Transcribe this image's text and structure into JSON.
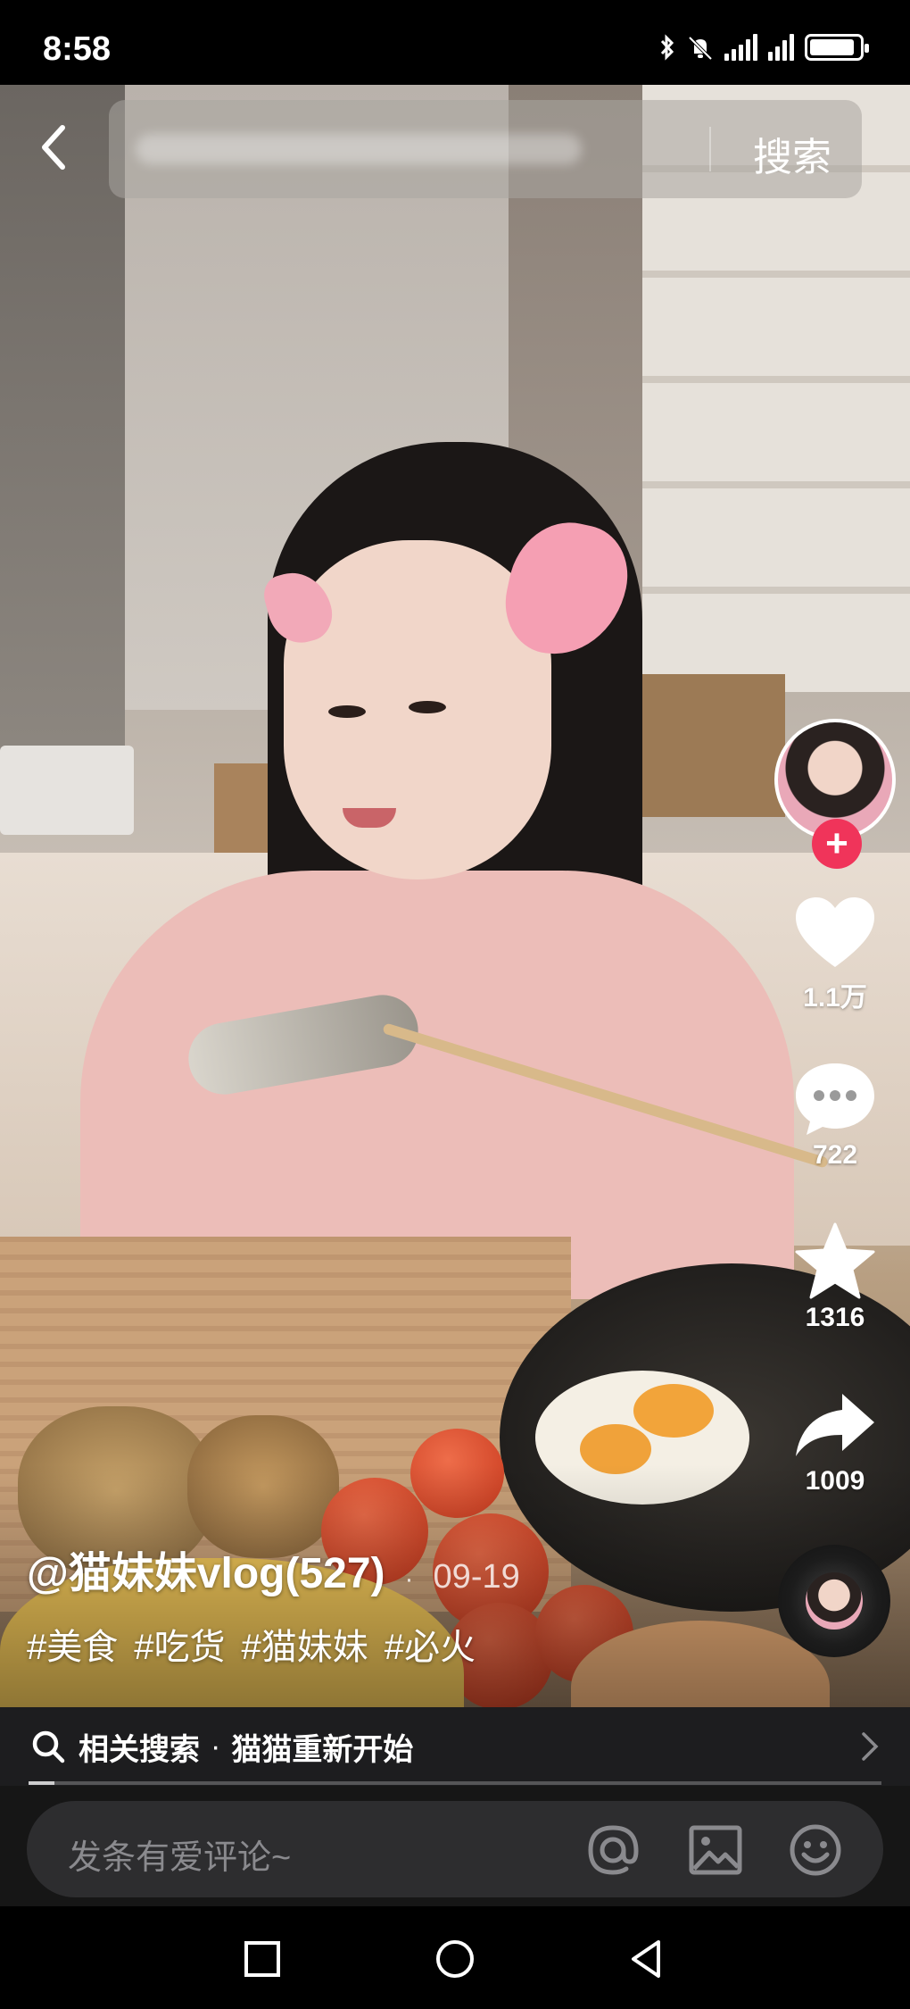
{
  "status_bar": {
    "time": "8:58",
    "icons": [
      "bluetooth-icon",
      "mute-icon",
      "signal-icon",
      "signal-icon",
      "battery-icon"
    ]
  },
  "search": {
    "button_label": "搜索"
  },
  "actions": {
    "likes": "1.1万",
    "comments": "722",
    "favorites": "1316",
    "shares": "1009"
  },
  "caption": {
    "author": "@猫妹妹vlog(527)",
    "separator": "·",
    "date": "09-19",
    "tags": [
      "#美食",
      "#吃货",
      "#猫妹妹",
      "#必火"
    ]
  },
  "related_search": {
    "label": "相关搜索",
    "separator": "·",
    "query": "猫猫重新开始"
  },
  "playback": {
    "progress": 0.03
  },
  "comment_bar": {
    "placeholder": "发条有爱评论~"
  },
  "colors": {
    "follow": "#f0345a",
    "bar_bg": "#1d1d1f",
    "input_bg": "#2d2d2f"
  }
}
